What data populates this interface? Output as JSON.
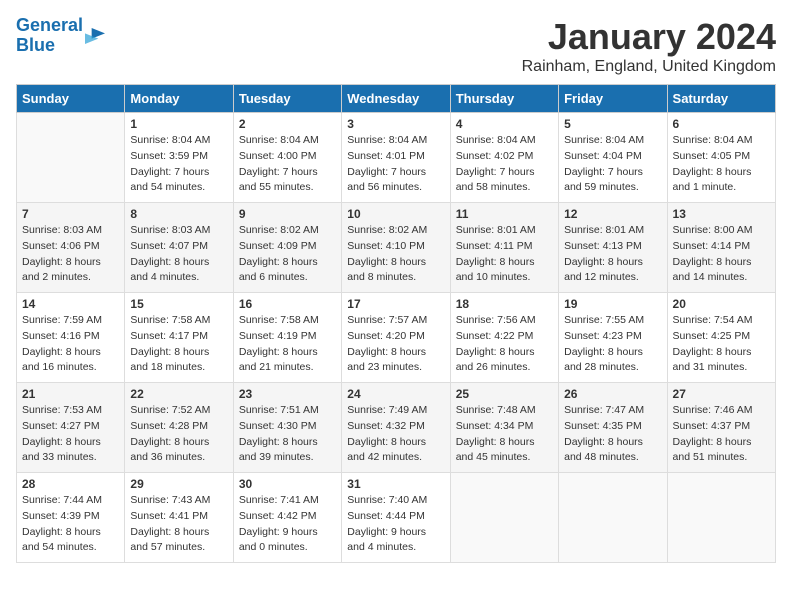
{
  "header": {
    "logo_line1": "General",
    "logo_line2": "Blue",
    "title": "January 2024",
    "location": "Rainham, England, United Kingdom"
  },
  "days_of_week": [
    "Sunday",
    "Monday",
    "Tuesday",
    "Wednesday",
    "Thursday",
    "Friday",
    "Saturday"
  ],
  "weeks": [
    [
      {
        "day": "",
        "sunrise": "",
        "sunset": "",
        "daylight": ""
      },
      {
        "day": "1",
        "sunrise": "Sunrise: 8:04 AM",
        "sunset": "Sunset: 3:59 PM",
        "daylight": "Daylight: 7 hours and 54 minutes."
      },
      {
        "day": "2",
        "sunrise": "Sunrise: 8:04 AM",
        "sunset": "Sunset: 4:00 PM",
        "daylight": "Daylight: 7 hours and 55 minutes."
      },
      {
        "day": "3",
        "sunrise": "Sunrise: 8:04 AM",
        "sunset": "Sunset: 4:01 PM",
        "daylight": "Daylight: 7 hours and 56 minutes."
      },
      {
        "day": "4",
        "sunrise": "Sunrise: 8:04 AM",
        "sunset": "Sunset: 4:02 PM",
        "daylight": "Daylight: 7 hours and 58 minutes."
      },
      {
        "day": "5",
        "sunrise": "Sunrise: 8:04 AM",
        "sunset": "Sunset: 4:04 PM",
        "daylight": "Daylight: 7 hours and 59 minutes."
      },
      {
        "day": "6",
        "sunrise": "Sunrise: 8:04 AM",
        "sunset": "Sunset: 4:05 PM",
        "daylight": "Daylight: 8 hours and 1 minute."
      }
    ],
    [
      {
        "day": "7",
        "sunrise": "Sunrise: 8:03 AM",
        "sunset": "Sunset: 4:06 PM",
        "daylight": "Daylight: 8 hours and 2 minutes."
      },
      {
        "day": "8",
        "sunrise": "Sunrise: 8:03 AM",
        "sunset": "Sunset: 4:07 PM",
        "daylight": "Daylight: 8 hours and 4 minutes."
      },
      {
        "day": "9",
        "sunrise": "Sunrise: 8:02 AM",
        "sunset": "Sunset: 4:09 PM",
        "daylight": "Daylight: 8 hours and 6 minutes."
      },
      {
        "day": "10",
        "sunrise": "Sunrise: 8:02 AM",
        "sunset": "Sunset: 4:10 PM",
        "daylight": "Daylight: 8 hours and 8 minutes."
      },
      {
        "day": "11",
        "sunrise": "Sunrise: 8:01 AM",
        "sunset": "Sunset: 4:11 PM",
        "daylight": "Daylight: 8 hours and 10 minutes."
      },
      {
        "day": "12",
        "sunrise": "Sunrise: 8:01 AM",
        "sunset": "Sunset: 4:13 PM",
        "daylight": "Daylight: 8 hours and 12 minutes."
      },
      {
        "day": "13",
        "sunrise": "Sunrise: 8:00 AM",
        "sunset": "Sunset: 4:14 PM",
        "daylight": "Daylight: 8 hours and 14 minutes."
      }
    ],
    [
      {
        "day": "14",
        "sunrise": "Sunrise: 7:59 AM",
        "sunset": "Sunset: 4:16 PM",
        "daylight": "Daylight: 8 hours and 16 minutes."
      },
      {
        "day": "15",
        "sunrise": "Sunrise: 7:58 AM",
        "sunset": "Sunset: 4:17 PM",
        "daylight": "Daylight: 8 hours and 18 minutes."
      },
      {
        "day": "16",
        "sunrise": "Sunrise: 7:58 AM",
        "sunset": "Sunset: 4:19 PM",
        "daylight": "Daylight: 8 hours and 21 minutes."
      },
      {
        "day": "17",
        "sunrise": "Sunrise: 7:57 AM",
        "sunset": "Sunset: 4:20 PM",
        "daylight": "Daylight: 8 hours and 23 minutes."
      },
      {
        "day": "18",
        "sunrise": "Sunrise: 7:56 AM",
        "sunset": "Sunset: 4:22 PM",
        "daylight": "Daylight: 8 hours and 26 minutes."
      },
      {
        "day": "19",
        "sunrise": "Sunrise: 7:55 AM",
        "sunset": "Sunset: 4:23 PM",
        "daylight": "Daylight: 8 hours and 28 minutes."
      },
      {
        "day": "20",
        "sunrise": "Sunrise: 7:54 AM",
        "sunset": "Sunset: 4:25 PM",
        "daylight": "Daylight: 8 hours and 31 minutes."
      }
    ],
    [
      {
        "day": "21",
        "sunrise": "Sunrise: 7:53 AM",
        "sunset": "Sunset: 4:27 PM",
        "daylight": "Daylight: 8 hours and 33 minutes."
      },
      {
        "day": "22",
        "sunrise": "Sunrise: 7:52 AM",
        "sunset": "Sunset: 4:28 PM",
        "daylight": "Daylight: 8 hours and 36 minutes."
      },
      {
        "day": "23",
        "sunrise": "Sunrise: 7:51 AM",
        "sunset": "Sunset: 4:30 PM",
        "daylight": "Daylight: 8 hours and 39 minutes."
      },
      {
        "day": "24",
        "sunrise": "Sunrise: 7:49 AM",
        "sunset": "Sunset: 4:32 PM",
        "daylight": "Daylight: 8 hours and 42 minutes."
      },
      {
        "day": "25",
        "sunrise": "Sunrise: 7:48 AM",
        "sunset": "Sunset: 4:34 PM",
        "daylight": "Daylight: 8 hours and 45 minutes."
      },
      {
        "day": "26",
        "sunrise": "Sunrise: 7:47 AM",
        "sunset": "Sunset: 4:35 PM",
        "daylight": "Daylight: 8 hours and 48 minutes."
      },
      {
        "day": "27",
        "sunrise": "Sunrise: 7:46 AM",
        "sunset": "Sunset: 4:37 PM",
        "daylight": "Daylight: 8 hours and 51 minutes."
      }
    ],
    [
      {
        "day": "28",
        "sunrise": "Sunrise: 7:44 AM",
        "sunset": "Sunset: 4:39 PM",
        "daylight": "Daylight: 8 hours and 54 minutes."
      },
      {
        "day": "29",
        "sunrise": "Sunrise: 7:43 AM",
        "sunset": "Sunset: 4:41 PM",
        "daylight": "Daylight: 8 hours and 57 minutes."
      },
      {
        "day": "30",
        "sunrise": "Sunrise: 7:41 AM",
        "sunset": "Sunset: 4:42 PM",
        "daylight": "Daylight: 9 hours and 0 minutes."
      },
      {
        "day": "31",
        "sunrise": "Sunrise: 7:40 AM",
        "sunset": "Sunset: 4:44 PM",
        "daylight": "Daylight: 9 hours and 4 minutes."
      },
      {
        "day": "",
        "sunrise": "",
        "sunset": "",
        "daylight": ""
      },
      {
        "day": "",
        "sunrise": "",
        "sunset": "",
        "daylight": ""
      },
      {
        "day": "",
        "sunrise": "",
        "sunset": "",
        "daylight": ""
      }
    ]
  ]
}
